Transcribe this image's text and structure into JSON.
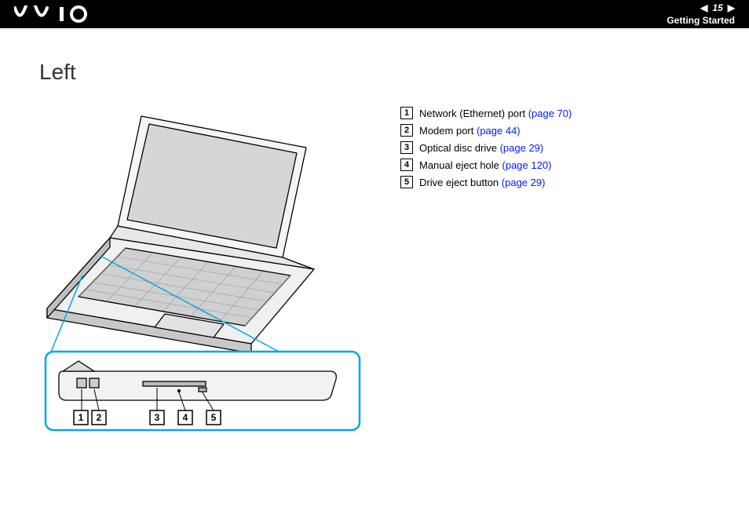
{
  "header": {
    "logo_text": "VAIO",
    "page_number": "15",
    "section": "Getting Started"
  },
  "page": {
    "title": "Left"
  },
  "callouts": {
    "labels": [
      "1",
      "2",
      "3",
      "4",
      "5"
    ]
  },
  "legend": [
    {
      "num": "1",
      "text": "Network (Ethernet) port ",
      "link": "(page 70)"
    },
    {
      "num": "2",
      "text": "Modem port ",
      "link": "(page 44)"
    },
    {
      "num": "3",
      "text": "Optical disc drive ",
      "link": "(page 29)"
    },
    {
      "num": "4",
      "text": "Manual eject hole ",
      "link": "(page 120)"
    },
    {
      "num": "5",
      "text": "Drive eject button ",
      "link": "(page 29)"
    }
  ]
}
